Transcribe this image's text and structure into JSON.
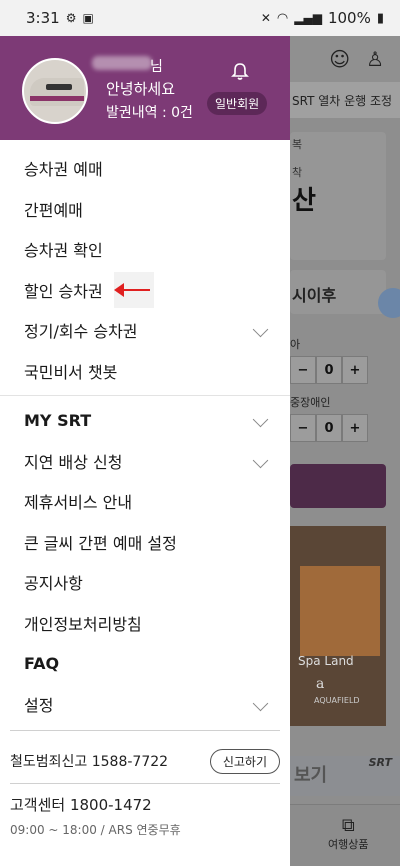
{
  "status_bar": {
    "time": "3:31",
    "battery": "100%"
  },
  "drawer": {
    "profile": {
      "name_suffix": "님",
      "greeting": "안녕하세요",
      "ticket_count": "발권내역 : 0건",
      "member_badge": "일반회원"
    },
    "menu_primary": [
      {
        "label": "승차권 예매"
      },
      {
        "label": "간편예매"
      },
      {
        "label": "승차권 확인"
      },
      {
        "label": "할인 승차권"
      },
      {
        "label": "정기/회수 승차권"
      },
      {
        "label": "국민비서 챗봇"
      }
    ],
    "menu_secondary": [
      {
        "label": "MY SRT"
      },
      {
        "label": "지연 배상 신청"
      },
      {
        "label": "제휴서비스 안내"
      },
      {
        "label": "큰 글씨 간편 예매 설정"
      },
      {
        "label": "공지사항"
      },
      {
        "label": "개인정보처리방침"
      },
      {
        "label": "FAQ"
      },
      {
        "label": "설정"
      }
    ],
    "footer": {
      "report_text": "철도범죄신고 1588-7722",
      "report_button": "신고하기",
      "cs_text": "고객센터 1800-1472",
      "hours": "09:00 ~ 18:00 / ARS 연중무휴"
    }
  },
  "background": {
    "notice": "SRT 열차 운행 조정",
    "label_bok": "복",
    "label_arrival": "착",
    "big_city": "산",
    "time_label": "시이후",
    "passenger_label_1": "아",
    "passenger_label_2": "중장애인",
    "count_1": "0",
    "count_2": "0",
    "ad_brand": "Spa Land",
    "ad_logo": "a",
    "ad_sub": "AQUAFIELD",
    "banner_text": "보기",
    "banner_srt": "SRT",
    "nav_label": "여행상품"
  },
  "colors": {
    "brand_purple": "#7d3a76",
    "badge_purple": "#5d2858",
    "annotation_red": "#e02020"
  }
}
